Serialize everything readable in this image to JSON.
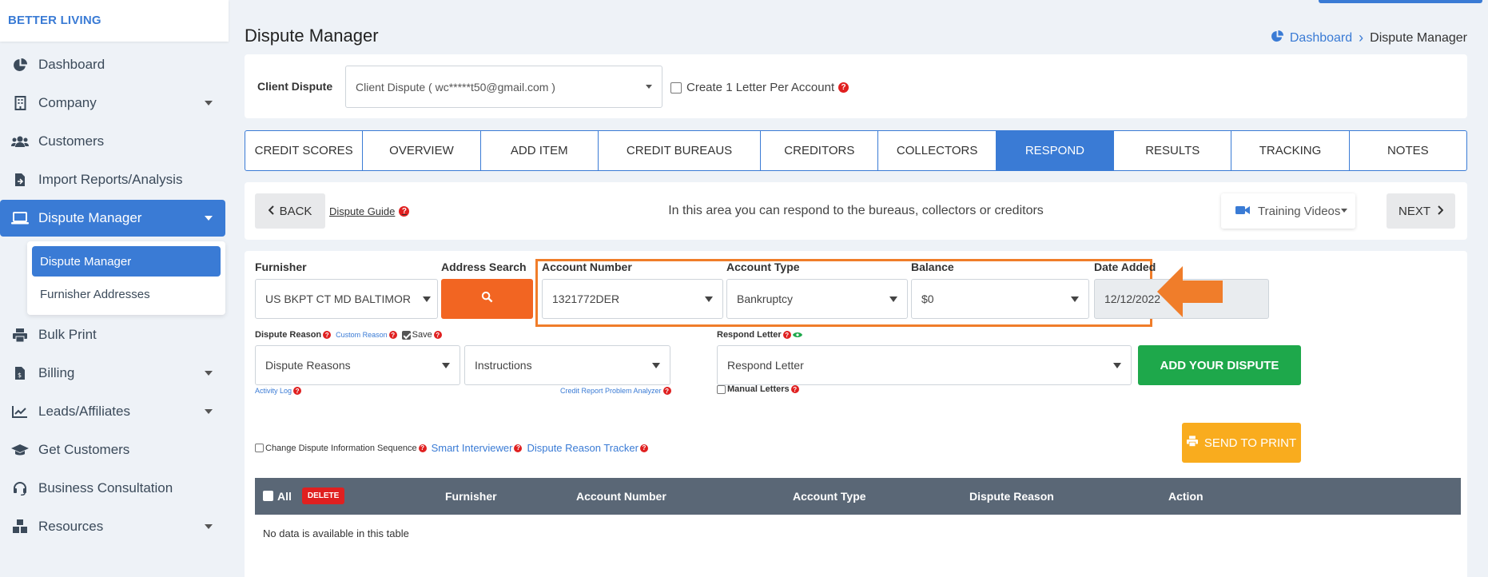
{
  "brand": {
    "name": "BETTER LIVING"
  },
  "sidebar": {
    "items": [
      {
        "label": "Dashboard",
        "icon": "dashboard-pie-icon"
      },
      {
        "label": "Company",
        "icon": "building-icon"
      },
      {
        "label": "Customers",
        "icon": "users-icon"
      },
      {
        "label": "Import Reports/Analysis",
        "icon": "file-import-icon"
      },
      {
        "label": "Dispute Manager",
        "icon": "laptop-icon",
        "active": true
      },
      {
        "label": "Bulk Print",
        "icon": "printer-icon"
      },
      {
        "label": "Billing",
        "icon": "invoice-icon"
      },
      {
        "label": "Leads/Affiliates",
        "icon": "chart-line-icon"
      },
      {
        "label": "Get Customers",
        "icon": "graduation-cap-icon"
      },
      {
        "label": "Business Consultation",
        "icon": "headset-icon"
      },
      {
        "label": "Resources",
        "icon": "boxes-icon"
      }
    ],
    "submenu": [
      {
        "label": "Dispute Manager",
        "active": true
      },
      {
        "label": "Furnisher Addresses"
      }
    ]
  },
  "header": {
    "title": "Dispute Manager",
    "breadcrumb": {
      "home": "Dashboard",
      "current": "Dispute Manager"
    }
  },
  "client": {
    "label": "Client Dispute",
    "selected": "Client Dispute ( wc*****t50@gmail.com )",
    "create_letter_label": "Create 1 Letter Per Account"
  },
  "tabs": [
    {
      "label": "CREDIT SCORES"
    },
    {
      "label": "OVERVIEW"
    },
    {
      "label": "ADD ITEM"
    },
    {
      "label": "CREDIT BUREAUS"
    },
    {
      "label": "CREDITORS"
    },
    {
      "label": "COLLECTORS"
    },
    {
      "label": "RESPOND",
      "active": true
    },
    {
      "label": "RESULTS"
    },
    {
      "label": "TRACKING"
    },
    {
      "label": "NOTES"
    }
  ],
  "navbar": {
    "back_label": "BACK",
    "guide_label": "Dispute Guide",
    "info_text": "In this area you can respond to the bureaus, collectors or creditors",
    "training_label": "Training Videos",
    "next_label": "NEXT"
  },
  "form": {
    "furnisher": {
      "label": "Furnisher",
      "value": "US BKPT CT MD BALTIMOR"
    },
    "address_search": {
      "label": "Address Search"
    },
    "account_number": {
      "label": "Account Number",
      "value": "1321772DER"
    },
    "account_type": {
      "label": "Account Type",
      "value": "Bankruptcy"
    },
    "balance": {
      "label": "Balance",
      "value": "$0"
    },
    "date_added": {
      "label": "Date Added",
      "value": "12/12/2022"
    },
    "dispute_reason": {
      "label": "Dispute Reason",
      "custom_link": "Custom Reason",
      "save_label": "Save",
      "value": "Dispute Reasons"
    },
    "instructions": {
      "value": "Instructions"
    },
    "respond_letter": {
      "label": "Respond Letter",
      "value": "Respond Letter"
    },
    "activity_log": "Activity Log",
    "problem_analyzer": "Credit Report Problem Analyzer",
    "manual_letters": "Manual Letters",
    "add_dispute_label": "ADD YOUR DISPUTE",
    "change_sequence": "Change Dispute Information Sequence",
    "smart_interviewer": "Smart Interviewer",
    "reason_tracker": "Dispute Reason Tracker",
    "send_print_label": "SEND TO PRINT"
  },
  "table": {
    "all_label": "All",
    "delete_label": "DELETE",
    "columns": [
      "Furnisher",
      "Account Number",
      "Account Type",
      "Dispute Reason",
      "Action"
    ],
    "empty_text": "No data is available in this table"
  },
  "colors": {
    "accent": "#3a7bd5",
    "search_button": "#f26522",
    "highlight": "#f07d2a",
    "add_dispute": "#1ea84b",
    "send_print": "#f9ac1e",
    "table_header": "#5a6776",
    "delete": "#e02020"
  }
}
